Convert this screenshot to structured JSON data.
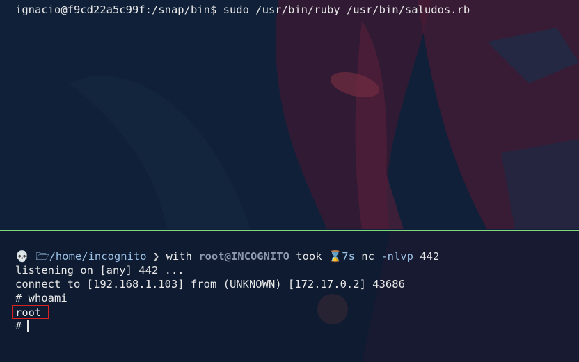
{
  "top_pane": {
    "prompt": "ignacio@f9cd22a5c99f:/snap/bin$",
    "command": "sudo /usr/bin/ruby /usr/bin/saludos.rb"
  },
  "bottom_pane": {
    "skull_icon": "💀",
    "folder_icon": "🗁",
    "path": "/home/incognito",
    "separator": "❯",
    "with_text": "with",
    "user_host": "root@INCOGNITO",
    "took_text": "took",
    "hourglass_icon": "⌛",
    "duration": "7s",
    "command_name": "nc",
    "command_flag": "-nlvp",
    "command_port": "442",
    "output_lines": [
      "listening on [any] 442 ...",
      "connect to [192.168.1.103] from (UNKNOWN) [172.17.0.2] 43686",
      "# whoami"
    ],
    "whoami_result": "root",
    "last_prompt": "#"
  },
  "colors": {
    "background": "#0d1a2e",
    "divider": "#7fd97a",
    "highlight_box": "#d62222"
  }
}
